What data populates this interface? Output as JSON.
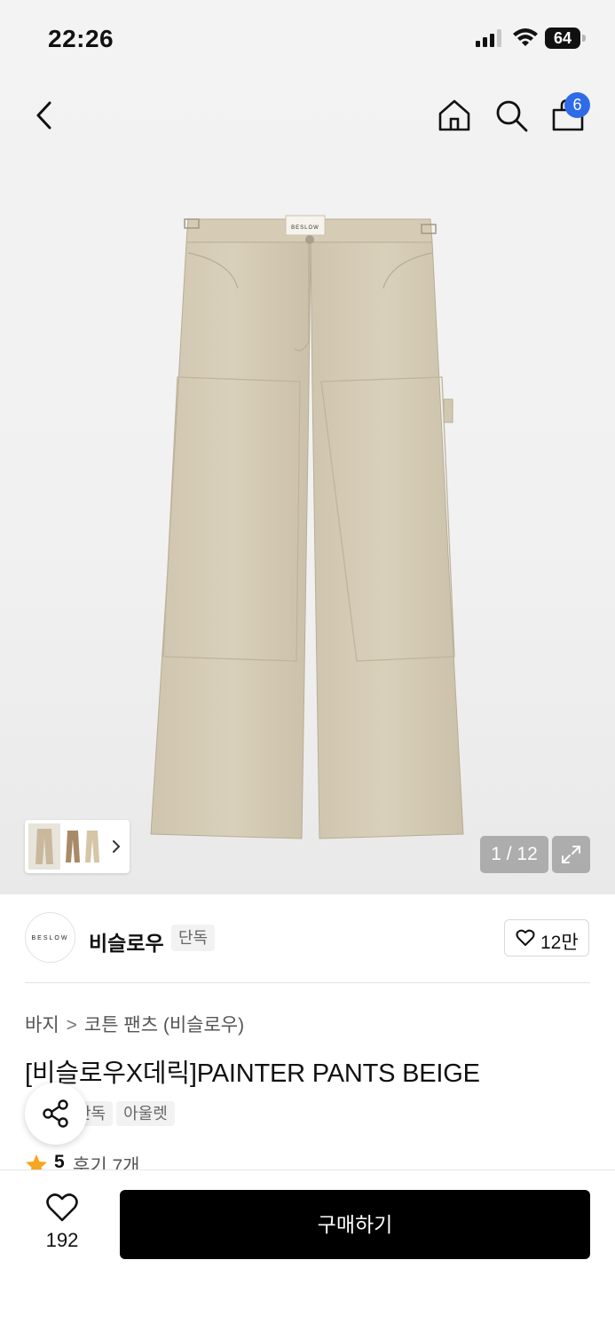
{
  "status_bar": {
    "time": "22:26",
    "battery_level": "64",
    "icons": [
      "signal-icon",
      "wifi-icon",
      "battery-icon"
    ]
  },
  "nav": {
    "icons": [
      "back-chevron-icon",
      "home-icon",
      "search-icon",
      "shopping-bag-icon"
    ],
    "cart_badge": "6",
    "accent_color": "#2f6be8"
  },
  "gallery": {
    "counter": "1 / 12",
    "expand_icon": "expand-icon",
    "brand_label_on_image": "BESLOW"
  },
  "brand": {
    "logo_text": "BESLOW",
    "name": "비슬로우",
    "tag": "단독",
    "likes": "12만"
  },
  "product": {
    "breadcrumb": [
      "바지",
      "코튼 팬츠 (비슬로우)"
    ],
    "title": "[비슬로우X데릭]PAINTER PANTS BEIGE",
    "tags": [
      "단독",
      "아울렛"
    ],
    "rating": "5",
    "reviews": "후기 7개",
    "star_color": "#f5a623"
  },
  "bottom": {
    "wish_count": "192",
    "buy_label": "구매하기"
  }
}
